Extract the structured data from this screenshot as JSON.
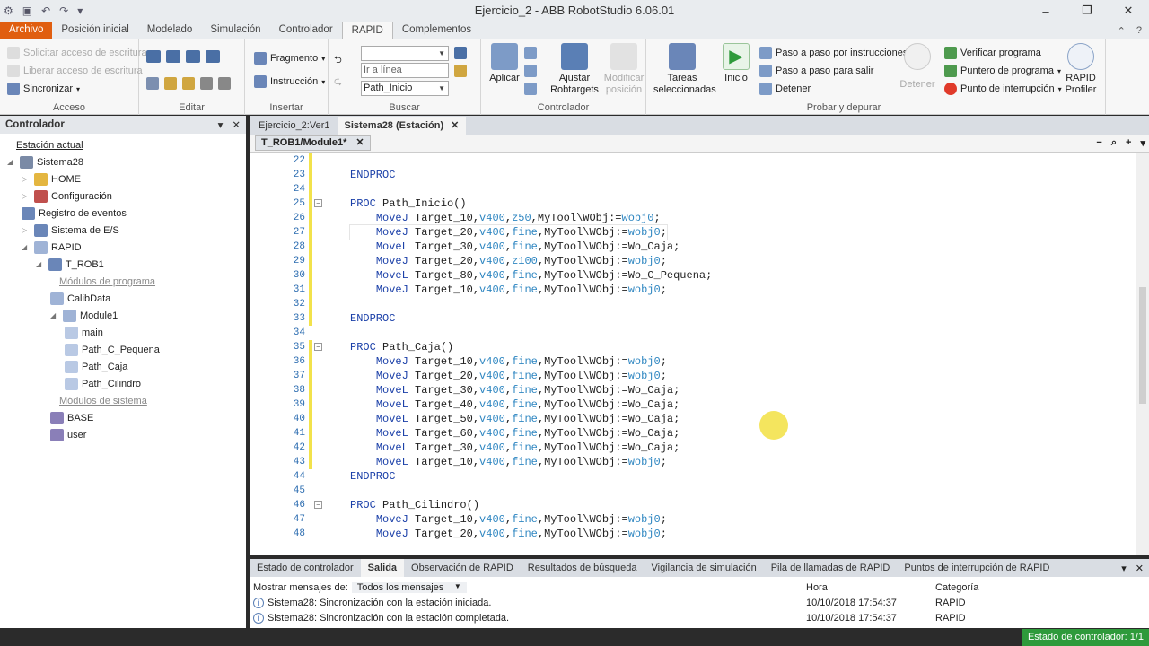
{
  "window": {
    "title": "Ejercicio_2 - ABB RobotStudio 6.06.01",
    "controls": [
      "–",
      "❐",
      "✕"
    ]
  },
  "ribbon_tabs": [
    "Archivo",
    "Posición inicial",
    "Modelado",
    "Simulación",
    "Controlador",
    "RAPID",
    "Complementos"
  ],
  "ribbon": {
    "acceso": {
      "label": "Acceso",
      "solicitar": "Solicitar acceso de escritura",
      "liberar": "Liberar acceso de escritura",
      "sincronizar": "Sincronizar"
    },
    "editar": {
      "label": "Editar"
    },
    "insertar": {
      "label": "Insertar",
      "fragmento": "Fragmento",
      "instruccion": "Instrucción"
    },
    "buscar": {
      "label": "Buscar",
      "search_value": "",
      "goto_placeholder": "Ir a línea",
      "path_value": "Path_Inicio"
    },
    "controlador": {
      "label": "Controlador",
      "aplicar": "Aplicar",
      "ajustar": [
        "Ajustar",
        "Robtargets"
      ],
      "modificar": [
        "Modificar",
        "posición"
      ]
    },
    "probar": {
      "label": "Probar y depurar",
      "tareas": [
        "Tareas",
        "seleccionadas"
      ],
      "inicio": "Inicio",
      "paso_instr": "Paso a paso por instrucciones",
      "paso_salir": "Paso a paso para salir",
      "detener": "Detener",
      "detener_big": "Detener",
      "verificar": "Verificar programa",
      "puntero": "Puntero de programa",
      "punto_int": "Punto de interrupción",
      "rapid_profiler": [
        "RAPID",
        "Profiler"
      ]
    }
  },
  "left_panel": {
    "title": "Controlador",
    "tree": [
      {
        "label": "Estación actual",
        "icon": "none",
        "style": "underline"
      },
      {
        "label": "Sistema28",
        "icon": "controller-icon"
      },
      {
        "label": "HOME",
        "icon": "folder-icon"
      },
      {
        "label": "Configuración",
        "icon": "config-icon"
      },
      {
        "label": "Registro de eventos",
        "icon": "log-icon"
      },
      {
        "label": "Sistema de E/S",
        "icon": "io-icon"
      },
      {
        "label": "RAPID",
        "icon": "rapid-icon"
      },
      {
        "label": "T_ROB1",
        "icon": "task-icon"
      },
      {
        "label": "Módulos de programa",
        "icon": "none",
        "style": "grey"
      },
      {
        "label": "CalibData",
        "icon": "module-icon"
      },
      {
        "label": "Module1",
        "icon": "module-icon"
      },
      {
        "label": "main",
        "icon": "proc-icon"
      },
      {
        "label": "Path_C_Pequena",
        "icon": "proc-icon"
      },
      {
        "label": "Path_Caja",
        "icon": "proc-icon"
      },
      {
        "label": "Path_Cilindro",
        "icon": "proc-icon"
      },
      {
        "label": "Módulos de sistema",
        "icon": "none",
        "style": "grey"
      },
      {
        "label": "BASE",
        "icon": "sysmod-icon"
      },
      {
        "label": "user",
        "icon": "sysmod-icon"
      }
    ]
  },
  "doc_tabs": [
    "Ejercicio_2:Ver1",
    "Sistema28 (Estación)"
  ],
  "editor_tab": "T_ROB1/Module1*",
  "code": [
    {
      "n": "22",
      "t": ""
    },
    {
      "n": "23",
      "t": "ENDPROC"
    },
    {
      "n": "24",
      "t": ""
    },
    {
      "n": "25",
      "t": "PROC Path_Inicio()"
    },
    {
      "n": "26",
      "t": "    MoveJ Target_10,v400,z50,MyTool\\WObj:=wobj0;"
    },
    {
      "n": "27",
      "t": "    MoveJ Target_20,v400,fine,MyTool\\WObj:=wobj0;"
    },
    {
      "n": "28",
      "t": "    MoveL Target_30,v400,fine,MyTool\\WObj:=Wo_Caja;"
    },
    {
      "n": "29",
      "t": "    MoveJ Target_20,v400,z100,MyTool\\WObj:=wobj0;"
    },
    {
      "n": "30",
      "t": "    MoveL Target_80,v400,fine,MyTool\\WObj:=Wo_C_Pequena;"
    },
    {
      "n": "31",
      "t": "    MoveJ Target_10,v400,fine,MyTool\\WObj:=wobj0;"
    },
    {
      "n": "32",
      "t": ""
    },
    {
      "n": "33",
      "t": "ENDPROC"
    },
    {
      "n": "34",
      "t": ""
    },
    {
      "n": "35",
      "t": "PROC Path_Caja()"
    },
    {
      "n": "36",
      "t": "    MoveJ Target_10,v400,fine,MyTool\\WObj:=wobj0;"
    },
    {
      "n": "37",
      "t": "    MoveJ Target_20,v400,fine,MyTool\\WObj:=wobj0;"
    },
    {
      "n": "38",
      "t": "    MoveL Target_30,v400,fine,MyTool\\WObj:=Wo_Caja;"
    },
    {
      "n": "39",
      "t": "    MoveL Target_40,v400,fine,MyTool\\WObj:=Wo_Caja;"
    },
    {
      "n": "40",
      "t": "    MoveL Target_50,v400,fine,MyTool\\WObj:=Wo_Caja;"
    },
    {
      "n": "41",
      "t": "    MoveL Target_60,v400,fine,MyTool\\WObj:=Wo_Caja;"
    },
    {
      "n": "42",
      "t": "    MoveL Target_30,v400,fine,MyTool\\WObj:=Wo_Caja;"
    },
    {
      "n": "43",
      "t": "    MoveL Target_10,v400,fine,MyTool\\WObj:=wobj0;"
    },
    {
      "n": "44",
      "t": "ENDPROC"
    },
    {
      "n": "45",
      "t": ""
    },
    {
      "n": "46",
      "t": "PROC Path_Cilindro()"
    },
    {
      "n": "47",
      "t": "    MoveJ Target_10,v400,fine,MyTool\\WObj:=wobj0;"
    },
    {
      "n": "48",
      "t": "    MoveJ Target_20,v400,fine,MyTool\\WObj:=wobj0;"
    }
  ],
  "output": {
    "tabs": [
      "Estado de controlador",
      "Salida",
      "Observación de RAPID",
      "Resultados de búsqueda",
      "Vigilancia de simulación",
      "Pila de llamadas de RAPID",
      "Puntos de interrupción de RAPID"
    ],
    "filter_label": "Mostrar mensajes de:",
    "filter_value": "Todos los mensajes",
    "col_hora": "Hora",
    "col_categoria": "Categoría",
    "rows": [
      {
        "msg": "Sistema28: Sincronización con la estación iniciada.",
        "hora": "10/10/2018 17:54:37",
        "cat": "RAPID"
      },
      {
        "msg": "Sistema28: Sincronización con la estación completada.",
        "hora": "10/10/2018 17:54:37",
        "cat": "RAPID"
      }
    ]
  },
  "status": {
    "text": "Estado de controlador: 1/1"
  },
  "colors": {
    "archivo": "#e05e10",
    "status_ok": "#2e9a3b",
    "keyword": "#1a3fa8",
    "bar": "#f2e24b"
  }
}
